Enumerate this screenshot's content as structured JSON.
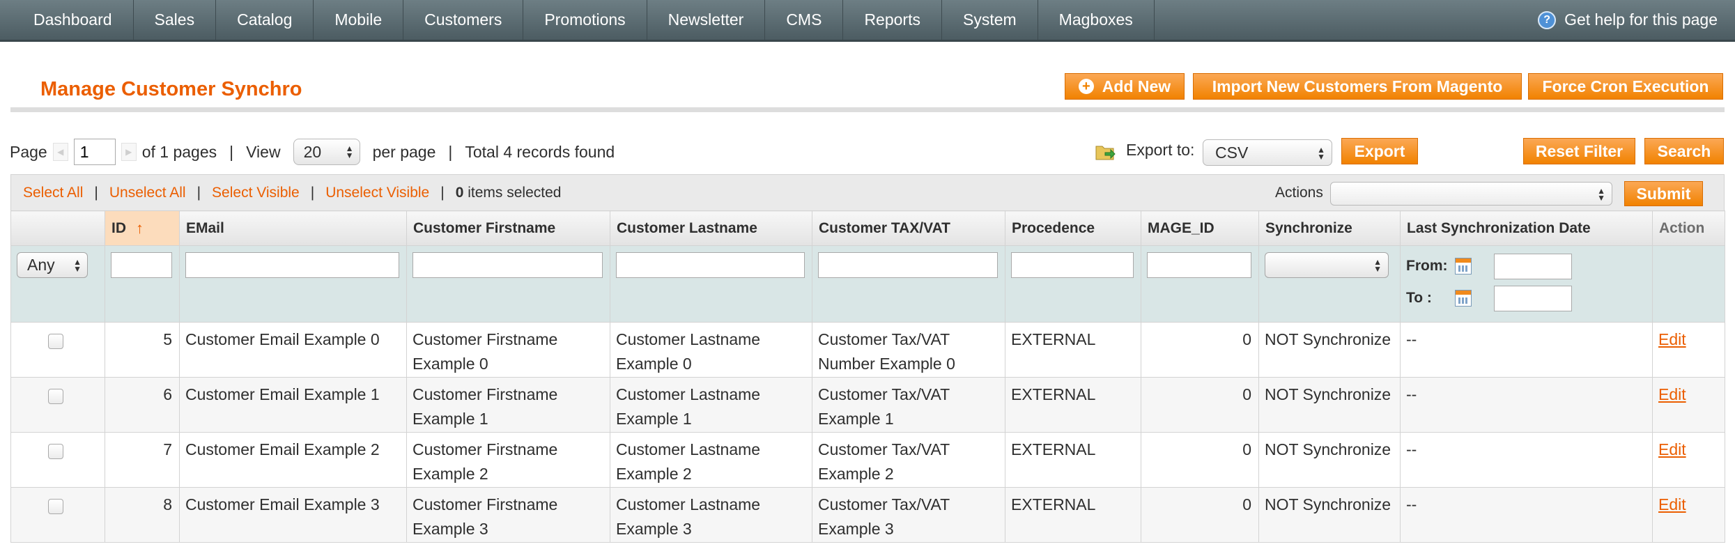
{
  "nav": {
    "items": [
      "Dashboard",
      "Sales",
      "Catalog",
      "Mobile",
      "Customers",
      "Promotions",
      "Newsletter",
      "CMS",
      "Reports",
      "System",
      "Magboxes"
    ],
    "help": "Get help for this page"
  },
  "header": {
    "title": "Manage Customer Synchro",
    "add_new": "Add New",
    "import": "Import New Customers From Magento",
    "cron": "Force Cron Execution"
  },
  "pager": {
    "page_label": "Page",
    "page_value": "1",
    "of_pages": "of 1 pages",
    "view_label": "View",
    "per_page_value": "20",
    "per_page_label": "per page",
    "total": "Total 4 records found",
    "export_label": "Export to:",
    "export_value": "CSV",
    "export_button": "Export",
    "reset_filter": "Reset Filter",
    "search": "Search"
  },
  "massaction": {
    "select_all": "Select All",
    "unselect_all": "Unselect All",
    "select_visible": "Select Visible",
    "unselect_visible": "Unselect Visible",
    "selected_count": "0",
    "selected_suffix": " items selected",
    "actions_label": "Actions",
    "actions_value": "",
    "submit": "Submit"
  },
  "grid": {
    "columns": [
      "ID",
      "EMail",
      "Customer Firstname",
      "Customer Lastname",
      "Customer TAX/VAT",
      "Procedence",
      "MAGE_ID",
      "Synchronize",
      "Last Synchronization Date",
      "Action"
    ],
    "filters": {
      "any": "Any",
      "from_label": "From:",
      "to_label": "To :"
    },
    "rows": [
      {
        "id": "5",
        "email": "Customer Email Example 0",
        "firstname": "Customer Firstname Example 0",
        "lastname": "Customer Lastname Example 0",
        "tax": "Customer Tax/VAT Number Example 0",
        "procedence": "EXTERNAL",
        "mage_id": "0",
        "sync": "NOT Synchronize",
        "last_sync": "--",
        "action": "Edit"
      },
      {
        "id": "6",
        "email": "Customer Email Example 1",
        "firstname": "Customer Firstname Example 1",
        "lastname": "Customer Lastname Example 1",
        "tax": "Customer Tax/VAT Example 1",
        "procedence": "EXTERNAL",
        "mage_id": "0",
        "sync": "NOT Synchronize",
        "last_sync": "--",
        "action": "Edit"
      },
      {
        "id": "7",
        "email": "Customer Email Example 2",
        "firstname": "Customer Firstname Example 2",
        "lastname": "Customer Lastname Example 2",
        "tax": "Customer Tax/VAT Example 2",
        "procedence": "EXTERNAL",
        "mage_id": "0",
        "sync": "NOT Synchronize",
        "last_sync": "--",
        "action": "Edit"
      },
      {
        "id": "8",
        "email": "Customer Email Example 3",
        "firstname": "Customer Firstname Example 3",
        "lastname": "Customer Lastname Example 3",
        "tax": "Customer Tax/VAT Example 3",
        "procedence": "EXTERNAL",
        "mage_id": "0",
        "sync": "NOT Synchronize",
        "last_sync": "--",
        "action": "Edit"
      }
    ]
  },
  "colors": {
    "accent": "#eb5e00",
    "button": "#f18200",
    "nav": "#5b6b71",
    "filter_bg": "#d9e6e6"
  }
}
